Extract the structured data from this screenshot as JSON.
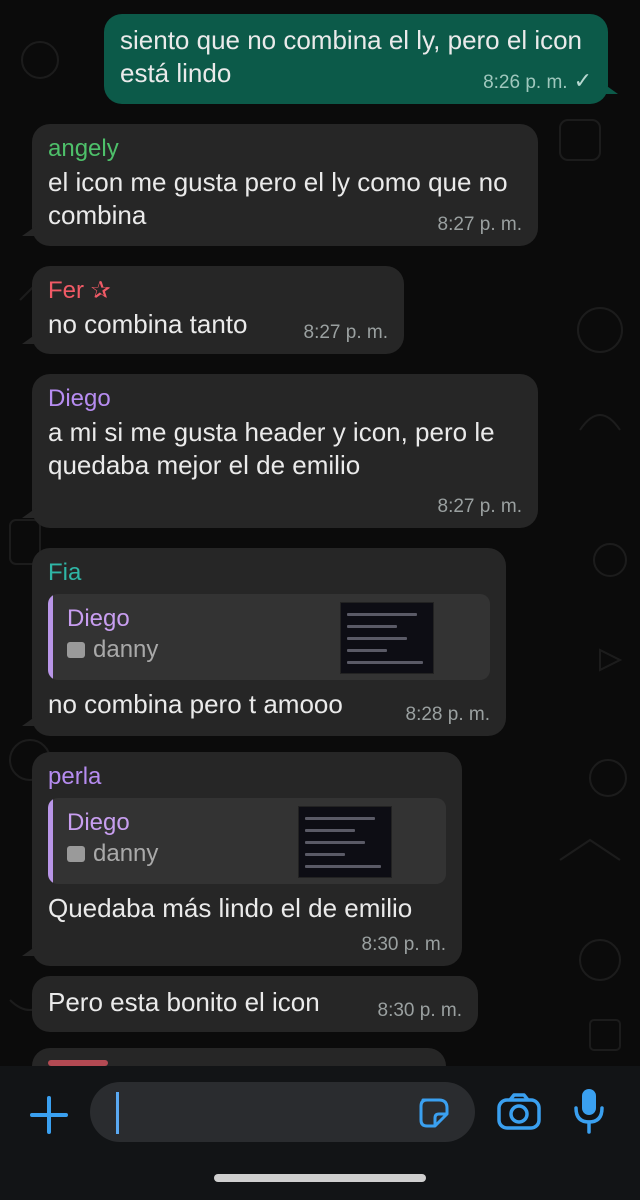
{
  "messages": [
    {
      "text": "siento que no combina el ly, pero el icon está lindo",
      "time": "8:26 p. m.",
      "check": "✓"
    },
    {
      "sender": "angely",
      "sender_color": "#4ec06a",
      "text": "el icon me gusta pero el ly como que no combina",
      "time": "8:27 p. m."
    },
    {
      "sender": "Fer ✰",
      "sender_color": "#f05a66",
      "text": "no combina tanto",
      "time": "8:27 p. m."
    },
    {
      "sender": "Diego",
      "sender_color": "#b68cf0",
      "text": "a mi si me gusta header y icon, pero le quedaba mejor el de emilio",
      "time": "8:27 p. m."
    },
    {
      "sender": "Fia",
      "sender_color": "#2fb6a6",
      "quote": {
        "name": "Diego",
        "media": "danny"
      },
      "text": "no combina pero t amooo",
      "time": "8:28 p. m."
    },
    {
      "sender": "perla",
      "sender_color": "#b68cf0",
      "quote": {
        "name": "Diego",
        "media": "danny"
      },
      "text": "Quedaba más lindo el de emilio",
      "time": "8:30 p. m."
    },
    {
      "text": "Pero esta bonito el icon",
      "time": "8:30 p. m."
    }
  ],
  "composer": {
    "placeholder": ""
  },
  "colors": {
    "accent": "#3aa0f0",
    "outgoing_bubble": "#0c5a49",
    "incoming_bubble": "#262626"
  }
}
